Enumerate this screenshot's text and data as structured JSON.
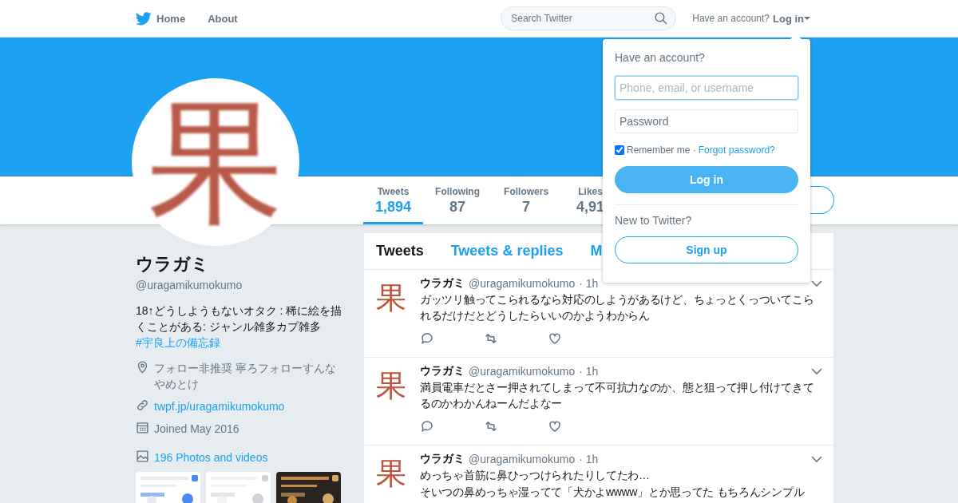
{
  "nav": {
    "links": [
      {
        "label": "Home",
        "kind": "home"
      },
      {
        "label": "About",
        "kind": "plain"
      }
    ],
    "search": {
      "placeholder": "Search Twitter"
    },
    "account_prompt": "Have an account?",
    "login_label": "Log in"
  },
  "profile": {
    "avatar_glyph": "果",
    "name": "ウラガミ",
    "handle": "@uragamikumokumo",
    "bio": "18↑どうしようもないオタク : 稀に絵を描くことがある: ジャンル雑多カプ雑多",
    "bio_hashtag": "#宇良上の備忘録",
    "location": "フォロー非推奨 寧ろフォローすんなやめとけ",
    "url": "twpf.jp/uragamikumokumo",
    "joined": "Joined May 2016",
    "photos_link": "196 Photos and videos"
  },
  "stats": [
    {
      "label": "Tweets",
      "value": "1,894",
      "selected": true
    },
    {
      "label": "Following",
      "value": "87",
      "selected": false
    },
    {
      "label": "Followers",
      "value": "7",
      "selected": false
    },
    {
      "label": "Likes",
      "value": "4,91",
      "selected": false
    }
  ],
  "timeline_tabs": [
    {
      "label": "Tweets",
      "selected": true
    },
    {
      "label": "Tweets & replies",
      "selected": false
    },
    {
      "label": "M",
      "selected": false
    }
  ],
  "tweets": [
    {
      "avatar_glyph": "果",
      "name": "ウラガミ",
      "handle": "@uragamikumokumo",
      "time": "· 1h",
      "lines": [
        "ガッツリ触ってこられるなら対応のしようがあるけど、ちょっとくっついてこられるだけだとどうしたらいいのかようわからん"
      ]
    },
    {
      "avatar_glyph": "果",
      "name": "ウラガミ",
      "handle": "@uragamikumokumo",
      "time": "· 1h",
      "lines": [
        "満員電車だとさー押されてしまって不可抗力なのか、態と狙って押し付けてきてるのかわかんねーんだよなー"
      ]
    },
    {
      "avatar_glyph": "果",
      "name": "ウラガミ",
      "handle": "@uragamikumokumo",
      "time": "· 1h",
      "lines": [
        "めっちゃ首筋に鼻ひっつけられたりしてたわ…",
        "そいつの鼻めっちゃ湿ってて「犬かよwwww」とか思ってた もちろんシンプル"
      ]
    }
  ],
  "login_dropdown": {
    "title": "Have an account?",
    "username": {
      "placeholder": "Phone, email, or username",
      "focused": true
    },
    "password": {
      "placeholder": "Password",
      "focused": false
    },
    "remember_me": {
      "label": "Remember me ·",
      "checked": true
    },
    "forgot_link": "Forgot password?",
    "login_button": "Log in",
    "new_prompt": "New to Twitter?",
    "signup_button": "Sign up"
  }
}
